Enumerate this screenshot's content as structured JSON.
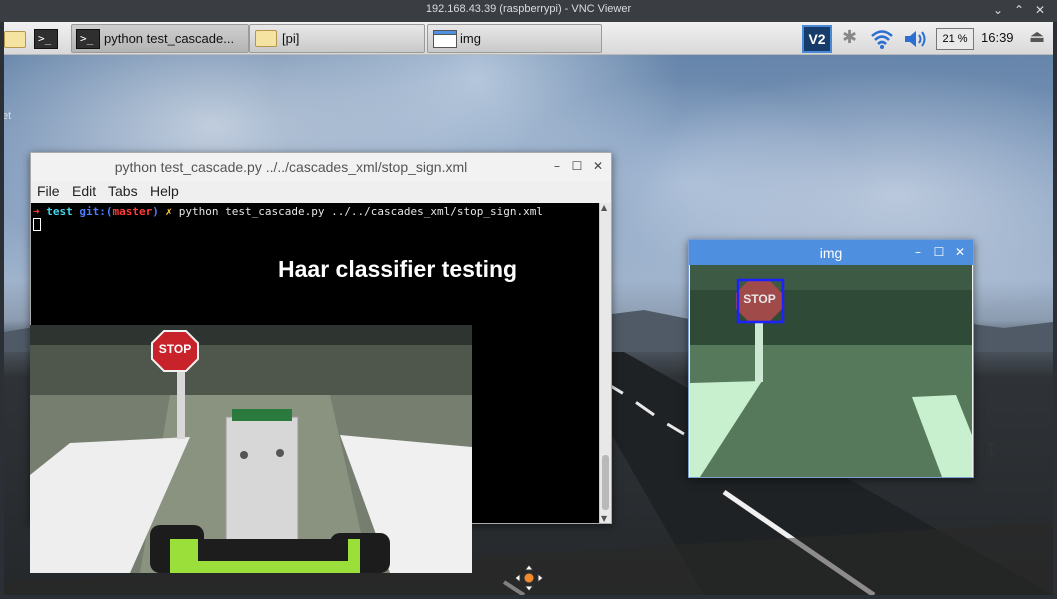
{
  "vnc": {
    "title": "192.168.43.39 (raspberrypi) - VNC Viewer",
    "controls": {
      "minimize": "⌄",
      "restore": "⌃",
      "close": "✕"
    }
  },
  "taskbar": {
    "launchers": [
      {
        "icon": "folder-icon"
      },
      {
        "icon": "terminal-icon",
        "glyph": ">_"
      }
    ],
    "tasks": [
      {
        "label": "python test_cascade...",
        "icon": "terminal-icon",
        "glyph": ">_"
      },
      {
        "label": "[pi]",
        "icon": "folder-icon"
      },
      {
        "label": "img",
        "icon": "window-icon"
      }
    ],
    "tray": {
      "vnc_glyph": "V2",
      "cpu": "21 %",
      "clock": "16:39",
      "bluetooth_glyph": "✱",
      "wifi_glyph": "◉",
      "volume_glyph": "◀))",
      "eject_glyph": "⏏"
    }
  },
  "desktop": {
    "edge_text": "et"
  },
  "terminal": {
    "title": "python test_cascade.py ../../cascades_xml/stop_sign.xml",
    "menu": [
      "File",
      "Edit",
      "Tabs",
      "Help"
    ],
    "prompt": {
      "arrow": "➜",
      "dir": "test",
      "git": "git:(",
      "branch": "master",
      "git_close": ")",
      "dirty": "✗",
      "command": "python test_cascade.py ../../cascades_xml/stop_sign.xml"
    },
    "controls": {
      "minimize": "–",
      "maximize": "☐",
      "close": "✕"
    }
  },
  "overlay": {
    "title": "Haar classifier testing"
  },
  "photo": {
    "stop_text": "STOP"
  },
  "img_window": {
    "title": "img",
    "stop_text": "STOP",
    "controls": {
      "minimize": "–",
      "maximize": "☐",
      "close": "✕"
    }
  },
  "colors": {
    "img_title_bar": "#4f8fe0",
    "prompt_arrow": "#ff3b3b",
    "prompt_dir": "#45d4e6",
    "prompt_git": "#4f7cff",
    "prompt_branch": "#ff3b3b",
    "prompt_dirty": "#ffd23d"
  }
}
